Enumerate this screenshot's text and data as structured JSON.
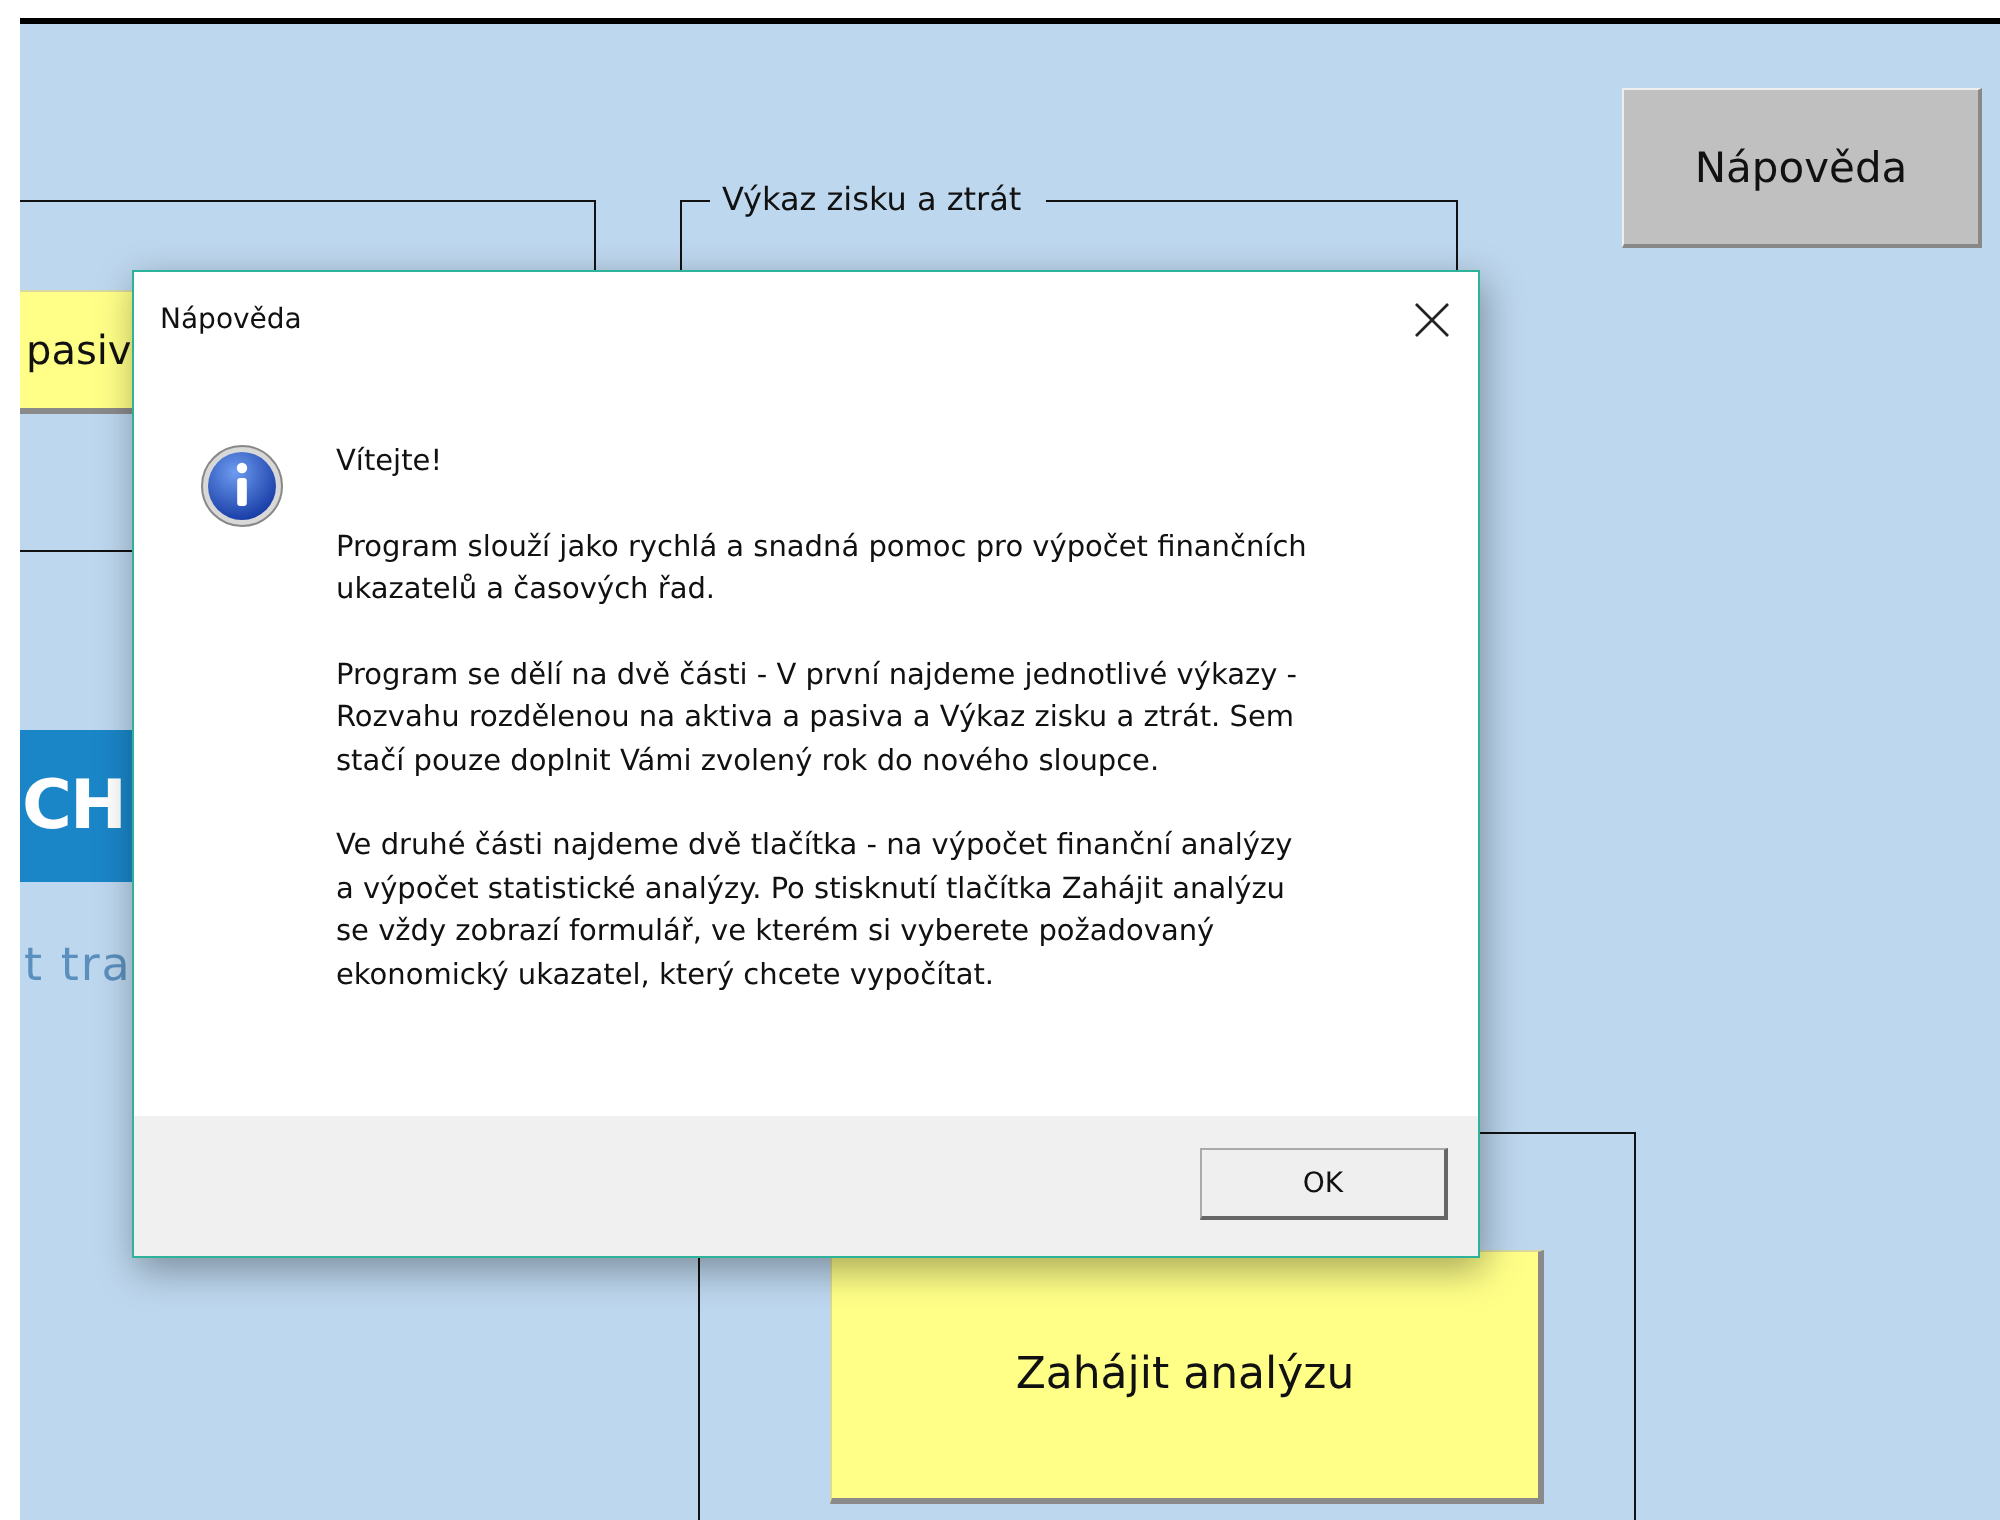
{
  "sheet": {
    "left_group": {
      "button_label": "pasiv"
    },
    "right_group": {
      "title": "Výkaz zisku a ztrát"
    },
    "logo": {
      "text": "CH",
      "tagline": "t tra"
    },
    "help_button": "Nápověda",
    "start_button": "Zahájit analýzu"
  },
  "dialog": {
    "title": "Nápověda",
    "heading": "Vítejte!",
    "paragraphs": [
      "Program slouží jako rychlá a snadná pomoc pro výpočet finančních ukazatelů a časových řad.",
      "Program se dělí na dvě části - V první najdeme jednotlivé výkazy - Rozvahu rozdělenou na aktiva a pasiva a Výkaz zisku a ztrát. Sem stačí pouze doplnit Vámi zvolený rok do nového sloupce.",
      "Ve druhé části najdeme dvě tlačítka - na výpočet finanční analýzy a výpočet statistické analýzy. Po stisknutí tlačítka Zahájit analýzu se vždy zobrazí formulář, ve kterém si vyberete požadovaný ekonomický ukazatel, který chcete vypočítat."
    ],
    "buttons": [
      "OK"
    ]
  }
}
